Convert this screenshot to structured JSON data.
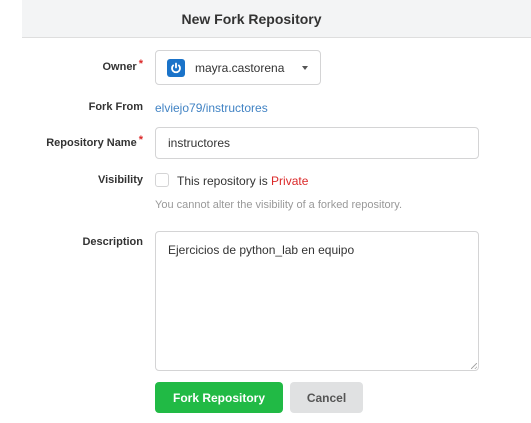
{
  "header": {
    "title": "New Fork Repository"
  },
  "form": {
    "owner": {
      "label": "Owner",
      "required_mark": "*",
      "value": "mayra.castorena",
      "avatar_color": "#1a73c9"
    },
    "fork_from": {
      "label": "Fork From",
      "link_text": "elviejo79/instructores"
    },
    "repo_name": {
      "label": "Repository Name",
      "required_mark": "*",
      "value": "instructores"
    },
    "visibility": {
      "label": "Visibility",
      "checkbox_text": "This repository is ",
      "private_text": "Private",
      "checked": false,
      "help_text": "You cannot alter the visibility of a forked repository."
    },
    "description": {
      "label": "Description",
      "value": "Ejercicios de python_lab en equipo"
    }
  },
  "actions": {
    "fork_label": "Fork Repository",
    "cancel_label": "Cancel"
  },
  "colors": {
    "primary": "#21ba45",
    "link": "#4183c4",
    "required": "#db2828"
  }
}
